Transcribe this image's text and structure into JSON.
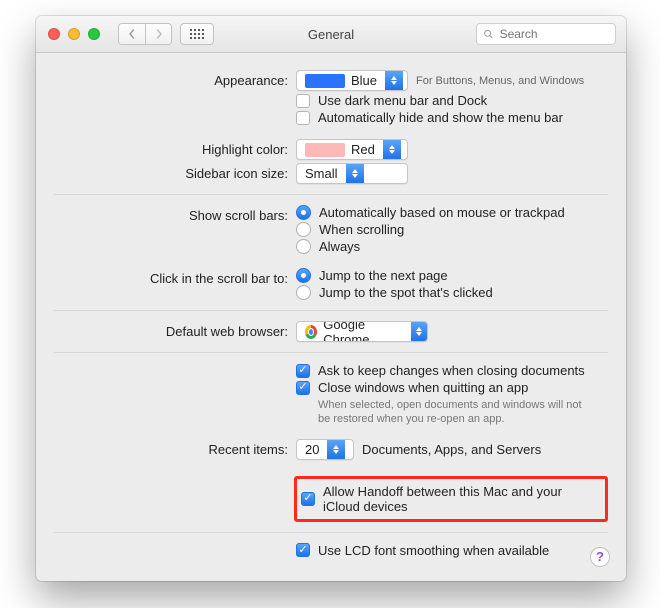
{
  "window": {
    "title": "General"
  },
  "search": {
    "placeholder": "Search"
  },
  "labels": {
    "appearance": "Appearance:",
    "highlight": "Highlight color:",
    "sidebar": "Sidebar icon size:",
    "scrollbars": "Show scroll bars:",
    "clickin": "Click in the scroll bar to:",
    "browser": "Default web browser:",
    "recent": "Recent items:"
  },
  "appearance": {
    "value": "Blue",
    "caption": "For Buttons, Menus, and Windows",
    "darkmenu": "Use dark menu bar and Dock",
    "autohide": "Automatically hide and show the menu bar"
  },
  "highlight": {
    "value": "Red"
  },
  "sidebar": {
    "value": "Small"
  },
  "scroll": {
    "auto": "Automatically based on mouse or trackpad",
    "when": "When scrolling",
    "always": "Always"
  },
  "click": {
    "next": "Jump to the next page",
    "spot": "Jump to the spot that's clicked"
  },
  "browser": {
    "value": "Google Chrome"
  },
  "keep": {
    "ask": "Ask to keep changes when closing documents",
    "close": "Close windows when quitting an app",
    "note": "When selected, open documents and windows will not be restored when you re-open an app."
  },
  "recent": {
    "value": "20",
    "caption": "Documents, Apps, and Servers"
  },
  "handoff": "Allow Handoff between this Mac and your iCloud devices",
  "lcd": "Use LCD font smoothing when available"
}
